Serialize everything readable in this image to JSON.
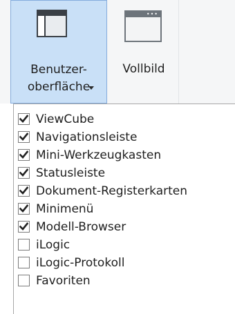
{
  "ribbon": {
    "user_interface_button": {
      "label_line1": "Benutzer-",
      "label_line2": "oberfläche",
      "icon": "window-with-panels-icon",
      "has_dropdown": true
    },
    "fullscreen_button": {
      "label": "Vollbild",
      "icon": "window-fullscreen-icon"
    }
  },
  "menu": {
    "items": [
      {
        "label": "ViewCube",
        "checked": true
      },
      {
        "label": "Navigationsleiste",
        "checked": true
      },
      {
        "label": "Mini-Werkzeugkasten",
        "checked": true
      },
      {
        "label": "Statusleiste",
        "checked": true
      },
      {
        "label": "Dokument-Registerkarten",
        "checked": true
      },
      {
        "label": "Minimenü",
        "checked": true
      },
      {
        "label": "Modell-Browser",
        "checked": true
      },
      {
        "label": "iLogic",
        "checked": false
      },
      {
        "label": "iLogic-Protokoll",
        "checked": false
      },
      {
        "label": "Favoriten",
        "checked": false
      }
    ]
  },
  "colors": {
    "selected_button_bg": "#c9e0f7",
    "selected_button_border": "#84acdd",
    "ribbon_bg": "#f5f6f7"
  }
}
